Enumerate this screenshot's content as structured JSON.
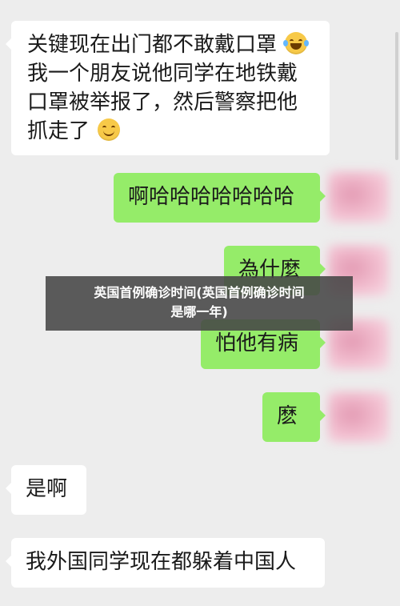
{
  "messages": [
    {
      "side": "incoming",
      "lines": [
        "关键现在出门都不敢戴口罩",
        "我一个朋友说他同学在地铁戴",
        "口罩被举报了，然后警察把他",
        "抓走了"
      ]
    },
    {
      "side": "outgoing",
      "text": "啊哈哈哈哈哈哈哈"
    },
    {
      "side": "outgoing",
      "text": "為什麼"
    },
    {
      "side": "outgoing",
      "text": "怕他有病"
    },
    {
      "side": "outgoing",
      "text": "麽"
    },
    {
      "side": "incoming",
      "text": "是啊"
    },
    {
      "side": "incoming",
      "text": "我外国同学现在都躲着中国人"
    }
  ],
  "icons": {
    "laugh": "tears-of-joy-emoji-icon",
    "smile": "smiling-emoji-icon"
  },
  "overlay": {
    "line1": "英国首例确诊时间(英国首例确诊时间",
    "line2": "是哪一年)"
  },
  "colors": {
    "background": "#ededed",
    "incoming": "#ffffff",
    "outgoing": "#95ec69",
    "overlay": "#464646"
  }
}
